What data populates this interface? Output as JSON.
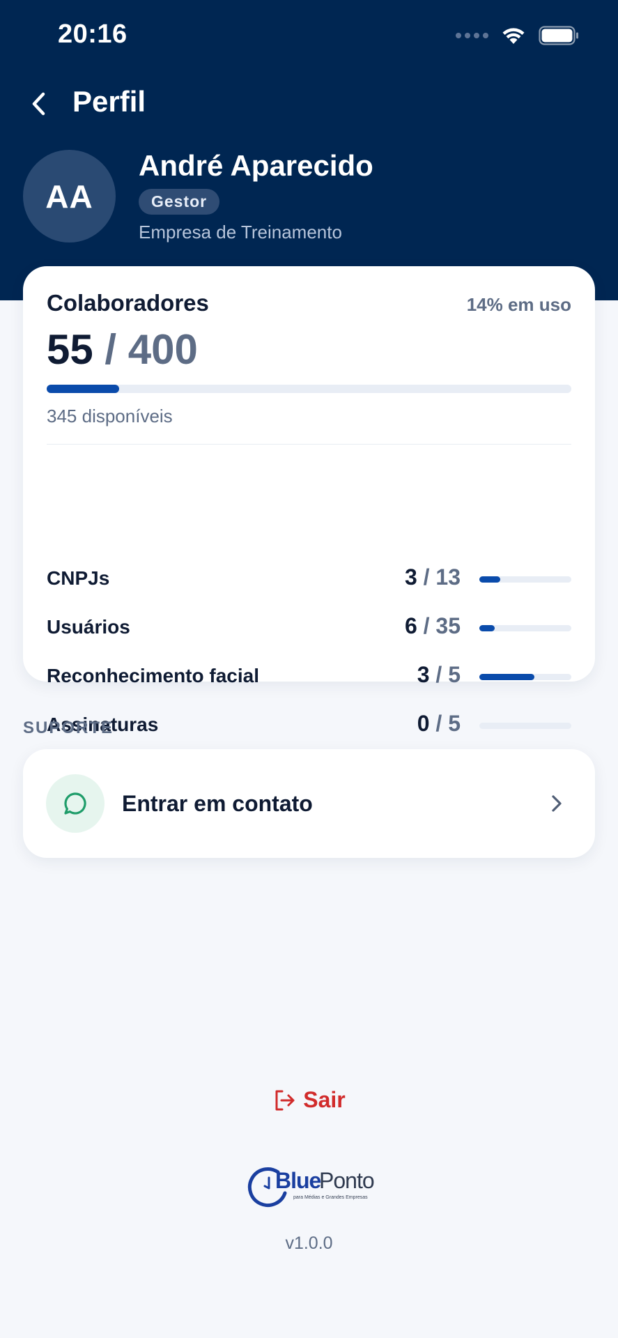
{
  "status_bar": {
    "time": "20:16"
  },
  "nav": {
    "title": "Perfil"
  },
  "profile": {
    "initials": "AA",
    "name": "André Aparecido",
    "role": "Gestor",
    "company": "Empresa de Treinamento"
  },
  "quota": {
    "title": "Colaboradores",
    "usage_label": "14% em uso",
    "used": "55",
    "separator": "/",
    "total": "400",
    "fill_fraction": 0.1375,
    "available_label": "345 disponíveis",
    "rows": [
      {
        "label": "CNPJs",
        "used": "3",
        "total": "13",
        "fill_fraction": 0.23
      },
      {
        "label": "Usuários",
        "used": "6",
        "total": "35",
        "fill_fraction": 0.17
      },
      {
        "label": "Reconhecimento facial",
        "used": "3",
        "total": "5",
        "fill_fraction": 0.6
      },
      {
        "label": "Assinaturas",
        "used": "0",
        "total": "5",
        "fill_fraction": 0
      }
    ]
  },
  "support": {
    "section_label": "SUPORTE",
    "contact_label": "Entrar em contato"
  },
  "logout": {
    "label": "Sair"
  },
  "brand": {
    "blue": "Blue",
    "ponto": "Ponto",
    "tagline": "para Médias e Grandes Empresas"
  },
  "version": "v1.0.0",
  "colors": {
    "header_bg": "#002652",
    "accent": "#0a4bab",
    "danger": "#d12b2b",
    "support_green": "#1f9d6a"
  },
  "icons": {
    "back": "chevron-left-icon",
    "support": "chat-bubble-icon",
    "chevron": "chevron-right-icon",
    "logout": "logout-icon",
    "wifi": "wifi-icon",
    "battery": "battery-icon"
  }
}
